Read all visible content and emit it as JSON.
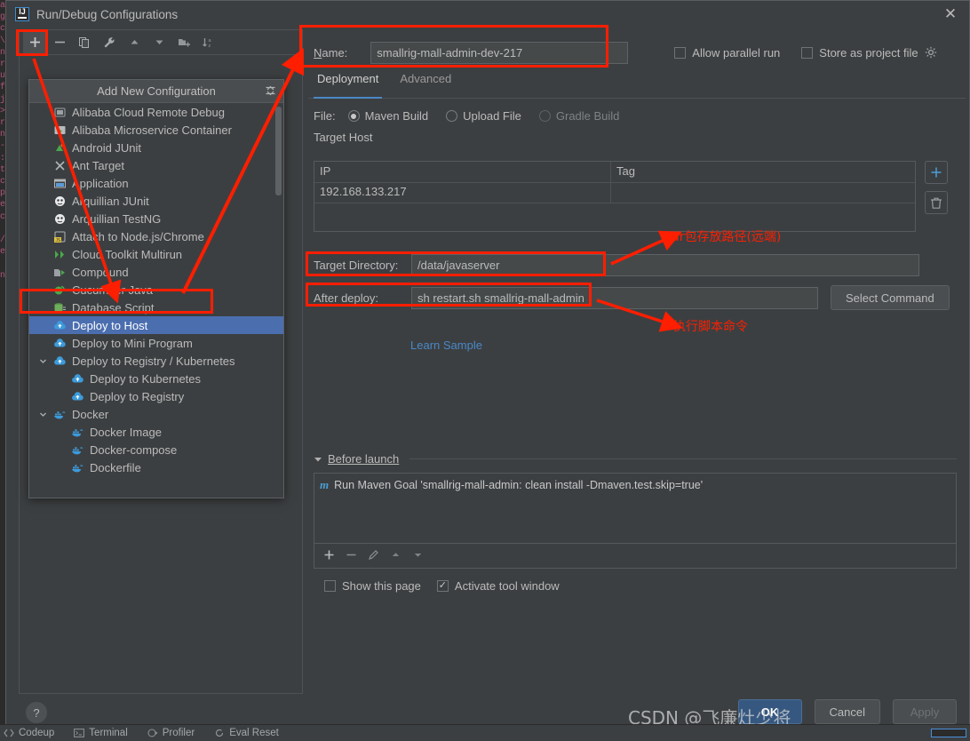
{
  "window": {
    "title": "Run/Debug Configurations",
    "logo_text": "IJ",
    "close_icon": "close-icon"
  },
  "toolbar": {
    "buttons": [
      {
        "name": "add-configuration",
        "glyph": "+",
        "pressed": true
      },
      {
        "name": "remove-configuration",
        "glyph": "−",
        "pressed": false
      },
      {
        "name": "copy-configuration",
        "glyph": "❐",
        "pressed": false
      },
      {
        "name": "edit-templates",
        "glyph": "🔧",
        "pressed": false
      },
      {
        "name": "move-up",
        "glyph": "▲",
        "pressed": false
      },
      {
        "name": "move-down",
        "glyph": "▼",
        "pressed": false
      },
      {
        "name": "move-into-folder",
        "glyph": "◰",
        "pressed": false
      },
      {
        "name": "sort-alphabetically",
        "glyph": "↓ᴀᶻ",
        "pressed": false
      }
    ]
  },
  "popup": {
    "header": "Add New Configuration",
    "collapse_icon": "collapse-all-icon",
    "items": [
      {
        "label": "Alibaba Cloud Remote Debug",
        "icon": "alibaba-remote-debug-icon",
        "indent": 0,
        "selected": false,
        "expander": ""
      },
      {
        "label": "Alibaba Microservice Container",
        "icon": "alibaba-microservice-icon",
        "indent": 0,
        "selected": false,
        "expander": ""
      },
      {
        "label": "Android JUnit",
        "icon": "android-junit-icon",
        "indent": 0,
        "selected": false,
        "expander": ""
      },
      {
        "label": "Ant Target",
        "icon": "ant-target-icon",
        "indent": 0,
        "selected": false,
        "expander": ""
      },
      {
        "label": "Application",
        "icon": "application-icon",
        "indent": 0,
        "selected": false,
        "expander": ""
      },
      {
        "label": "Arquillian JUnit",
        "icon": "arquillian-junit-icon",
        "indent": 0,
        "selected": false,
        "expander": ""
      },
      {
        "label": "Arquillian TestNG",
        "icon": "arquillian-testng-icon",
        "indent": 0,
        "selected": false,
        "expander": ""
      },
      {
        "label": "Attach to Node.js/Chrome",
        "icon": "attach-nodejs-icon",
        "indent": 0,
        "selected": false,
        "expander": ""
      },
      {
        "label": "Cloud Toolkit Multirun",
        "icon": "cloud-toolkit-multirun-icon",
        "indent": 0,
        "selected": false,
        "expander": ""
      },
      {
        "label": "Compound",
        "icon": "compound-icon",
        "indent": 0,
        "selected": false,
        "expander": ""
      },
      {
        "label": "Cucumber Java",
        "icon": "cucumber-java-icon",
        "indent": 0,
        "selected": false,
        "expander": ""
      },
      {
        "label": "Database Script",
        "icon": "database-script-icon",
        "indent": 0,
        "selected": false,
        "expander": ""
      },
      {
        "label": "Deploy to Host",
        "icon": "deploy-cloud-icon",
        "indent": 0,
        "selected": true,
        "expander": ""
      },
      {
        "label": "Deploy to Mini Program",
        "icon": "deploy-cloud-icon",
        "indent": 0,
        "selected": false,
        "expander": ""
      },
      {
        "label": "Deploy to Registry / Kubernetes",
        "icon": "deploy-cloud-icon",
        "indent": 0,
        "selected": false,
        "expander": "⌄"
      },
      {
        "label": "Deploy to Kubernetes",
        "icon": "deploy-cloud-icon",
        "indent": 1,
        "selected": false,
        "expander": ""
      },
      {
        "label": "Deploy to Registry",
        "icon": "deploy-cloud-icon",
        "indent": 1,
        "selected": false,
        "expander": ""
      },
      {
        "label": "Docker",
        "icon": "docker-icon",
        "indent": 0,
        "selected": false,
        "expander": "⌄"
      },
      {
        "label": "Docker Image",
        "icon": "docker-icon",
        "indent": 1,
        "selected": false,
        "expander": ""
      },
      {
        "label": "Docker-compose",
        "icon": "docker-icon",
        "indent": 1,
        "selected": false,
        "expander": ""
      },
      {
        "label": "Dockerfile",
        "icon": "docker-icon",
        "indent": 1,
        "selected": false,
        "expander": ""
      }
    ]
  },
  "form": {
    "name_label": "Name:",
    "name_value": "smallrig-mall-admin-dev-217",
    "allow_parallel_run": {
      "label": "Allow parallel run",
      "checked": false
    },
    "store_as_project_file": {
      "label": "Store as project file",
      "checked": false,
      "gear_icon": "gear-icon"
    },
    "tabs": [
      {
        "label": "Deployment",
        "active": true
      },
      {
        "label": "Advanced",
        "active": false
      }
    ],
    "file_label": "File:",
    "file_options": [
      {
        "label": "Maven Build",
        "selected": true,
        "enabled": true
      },
      {
        "label": "Upload File",
        "selected": false,
        "enabled": true
      },
      {
        "label": "Gradle Build",
        "selected": false,
        "enabled": false
      }
    ],
    "target_host_label": "Target Host",
    "host_table": {
      "columns": [
        "IP",
        "Tag"
      ],
      "rows": [
        [
          "192.168.133.217",
          ""
        ]
      ]
    },
    "host_add_icon": "plus-icon",
    "host_delete_icon": "trash-icon",
    "target_directory": {
      "label": "Target Directory:",
      "value": "/data/javaserver"
    },
    "after_deploy": {
      "label": "After deploy:",
      "value": "sh restart.sh smallrig-mall-admin"
    },
    "select_command_button": "Select Command",
    "learn_sample_link": "Learn Sample"
  },
  "before_launch": {
    "title": "Before launch",
    "expander_icon": "triangle-down-icon",
    "items": [
      {
        "icon": "maven-icon",
        "icon_text": "m",
        "text": "Run Maven Goal 'smallrig-mall-admin: clean install -Dmaven.test.skip=true'"
      }
    ],
    "tools": [
      {
        "name": "add-task",
        "glyph": "+"
      },
      {
        "name": "remove-task",
        "glyph": "−"
      },
      {
        "name": "edit-task",
        "glyph": "✎"
      },
      {
        "name": "move-task-up",
        "glyph": "▲"
      },
      {
        "name": "move-task-down",
        "glyph": "▼"
      }
    ],
    "show_this_page": {
      "label": "Show this page",
      "checked": false
    },
    "activate_tool_window": {
      "label": "Activate tool window",
      "checked": true
    }
  },
  "footer": {
    "help_icon": "help-icon",
    "ok_button": "OK",
    "cancel_button": "Cancel",
    "apply_button": "Apply"
  },
  "status_bar": {
    "items": [
      {
        "label": "Codeup",
        "icon": "codeup-icon"
      },
      {
        "label": "Terminal",
        "icon": "terminal-icon"
      },
      {
        "label": "Profiler",
        "icon": "profiler-icon"
      },
      {
        "label": "Eval Reset",
        "icon": "eval-reset-icon"
      }
    ]
  },
  "annotations": {
    "jar_path_note": "Jar包存放路径(远端)",
    "script_cmd_note": "执行脚本命令",
    "highlight_color": "#fe1e00"
  },
  "watermark": {
    "text": "CSDN @飞廉灶少将"
  },
  "background_code": "ar\ng\nca\n\\\nn\nre\nup\nf\nj\n>\nr\nne\n-\n:\nto\nc\npp\nen\nco\n\n/\ne\n\nn"
}
